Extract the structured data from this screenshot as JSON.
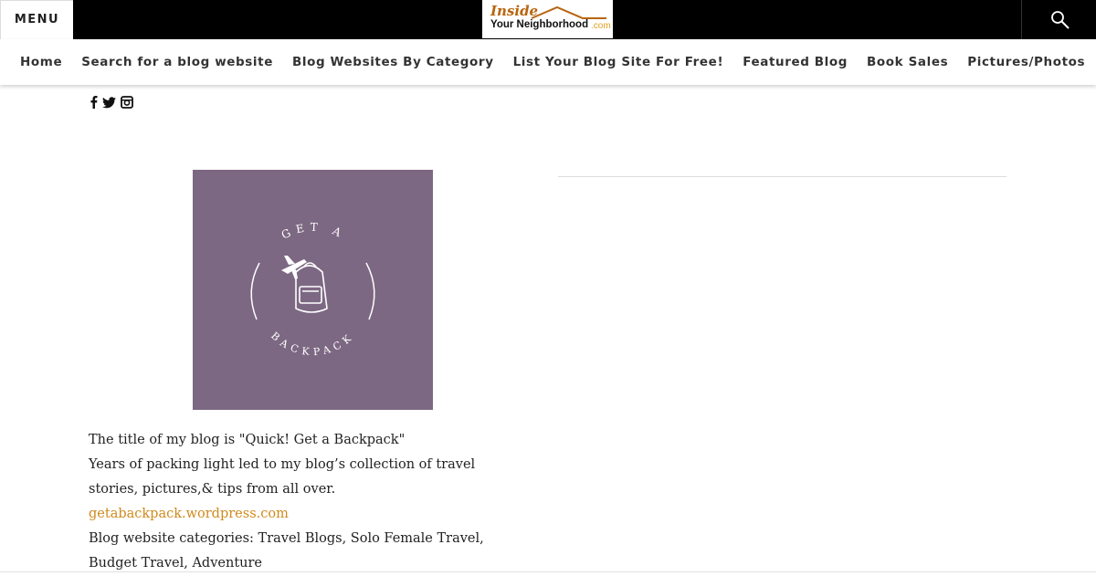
{
  "header": {
    "menu_label": "MENU",
    "logo": {
      "line1": "Inside",
      "line2": "Your Neighborhood",
      "suffix": ".com"
    },
    "search_icon": "search-icon"
  },
  "nav": {
    "items": [
      {
        "label": "Home"
      },
      {
        "label": "Search for a blog website"
      },
      {
        "label": "Blog Websites By Category"
      },
      {
        "label": "List Your Blog Site For Free!"
      },
      {
        "label": "Featured Blog"
      },
      {
        "label": "Book Sales"
      },
      {
        "label": "Pictures/Photos"
      }
    ]
  },
  "social": {
    "icons": [
      "facebook-icon",
      "twitter-icon",
      "instagram-icon"
    ]
  },
  "image": {
    "top_text": "GET A",
    "bottom_text": "BACKPACK",
    "background": "#7d6883"
  },
  "post": {
    "title_line": "The title of my blog is \"Quick! Get a Backpack\"",
    "description": "Years of packing light led to my blog’s collection of travel stories, pictures,& tips from all over.",
    "link": "getabackpack.wordpress.com",
    "categories": "Blog website categories: Travel Blogs, Solo Female Travel, Budget Travel, Adventure"
  },
  "colors": {
    "topbar": "#000000",
    "link": "#d08a1c",
    "logo_accent": "#b8650f"
  }
}
